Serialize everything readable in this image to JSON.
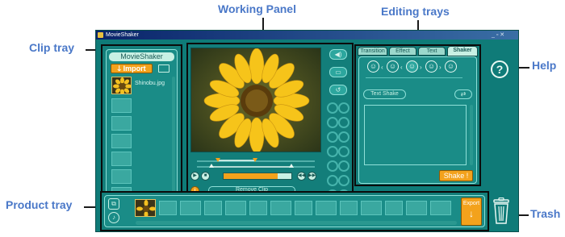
{
  "callouts": {
    "working_panel": "Working Panel",
    "editing_trays": "Editing trays",
    "clip_tray": "Clip tray",
    "help": "Help",
    "product_tray": "Product tray",
    "trash": "Trash"
  },
  "window": {
    "title": "MovieShaker",
    "controls": "_ ▫ ✕"
  },
  "clip_tray": {
    "header": "MovieShaker",
    "import_label": "Import",
    "import_arrow": "🡓",
    "clips": [
      {
        "name": "Shinobu.jpg"
      }
    ],
    "icons": [
      "view-toggle-icon"
    ]
  },
  "working_panel": {
    "status_text": "Remove Clip",
    "side_buttons": [
      "◀)",
      "▭",
      "↺"
    ],
    "transport": [
      "▶",
      "■",
      "◀◀",
      "▶▶"
    ],
    "progress": 0.8,
    "icons": [
      "volume-icon",
      "fullscreen-icon",
      "rotate-icon",
      "trim-marker-icon",
      "play-icon",
      "stop-icon",
      "rewind-icon",
      "forward-icon",
      "clip-info-icon",
      "timer-icon"
    ]
  },
  "editing_trays": {
    "tabs": [
      "Transition",
      "Effect",
      "Text",
      "Shaker"
    ],
    "active_tab": "Shaker",
    "faces": [
      "☺",
      "☺",
      "☺",
      "☺",
      "☺"
    ],
    "text_shake_label": "Text Shake",
    "refresh_symbol": "⇄",
    "shake_label": "Shake !"
  },
  "help": {
    "symbol": "?"
  },
  "product_tray": {
    "export_label": "Export",
    "export_arrow": "↓",
    "icons": [
      "product-view-icon",
      "music-icon"
    ],
    "slot_count": 13
  },
  "colors": {
    "accent": "#f3a21c",
    "panel": "#137e7a",
    "callout": "#4a78c8",
    "border": "#0b0b0b"
  }
}
